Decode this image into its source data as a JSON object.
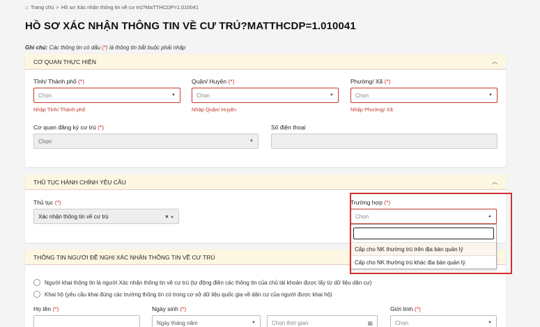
{
  "breadcrumb": {
    "home": "Trang chủ",
    "separator": ">",
    "current": "Hồ sơ Xác nhận thông tin về cư trú?MaTTHCDP=1.010041"
  },
  "page_title": "HỒ SƠ XÁC NHẬN THÔNG TIN VỀ CƯ TRÚ?MATTHCDP=1.010041",
  "note": {
    "label": "Ghi chú:",
    "text_before": " Các thông tin có dấu ",
    "marker": "(*)",
    "text_after": " là thông tin bắt buộc phải nhập"
  },
  "required_marker": "(*)",
  "section1": {
    "title": "CƠ QUAN THỰC HIỆN",
    "tinh": {
      "label": "Tỉnh/ Thành phố",
      "value": "Chọn",
      "helper": "Nhập Tỉnh/ Thành phố"
    },
    "quan": {
      "label": "Quận/ Huyện",
      "value": "Chọn",
      "helper": "Nhập Quận/ Huyện"
    },
    "phuong": {
      "label": "Phường/ Xã",
      "value": "Chọn",
      "helper": "Nhập Phường/ Xã"
    },
    "coquan": {
      "label": "Cơ quan đăng ký cư trú",
      "value": "Chọn"
    },
    "sdt": {
      "label": "Số điện thoại",
      "value": ""
    }
  },
  "section2": {
    "title": "THỦ TỤC HÀNH CHÍNH YÊU CẦU",
    "thutuc": {
      "label": "Thủ tục",
      "value": "Xác nhận thông tin về cư trú",
      "clear": "×"
    },
    "truonghop": {
      "label": "Trường hợp",
      "value": "Chọn"
    },
    "dropdown": {
      "search_value": "",
      "options": [
        "Cấp cho NK thường trú trên địa bàn quản lý",
        "Cấp cho NK thường trú khác địa bàn quản lý"
      ]
    }
  },
  "section3": {
    "title": "THÔNG TIN NGƯỜI ĐỀ NGHỊ XÁC NHẬN THÔNG TIN VỀ CƯ TRÚ",
    "radio1": "Người khai thông tin là người Xác nhận thông tin về cư trú (tự động điền các thông tin của chủ tài khoản được lấy từ dữ liệu dân cư)",
    "radio2": "Khai hộ (yêu cầu khai đúng các trường thông tin có trong cơ sở dữ liệu quốc gia về dân cư của người được khai hộ)",
    "hoten": {
      "label": "Họ tên",
      "value": ""
    },
    "ngaysinh": {
      "label": "Ngày sinh",
      "value": "Ngày tháng năm",
      "time_placeholder": "Chọn thời gian"
    },
    "gioitinh": {
      "label": "Giới tính",
      "value": "Chọn"
    }
  },
  "icons": {
    "home": "home-icon",
    "chevron_up": "chevron-up-icon",
    "caret": "caret-down-icon",
    "calendar": "calendar-icon"
  },
  "colors": {
    "required": "#d32f2f",
    "section_header_bg": "#fdf7e1",
    "highlight_box": "#d32f2f"
  }
}
